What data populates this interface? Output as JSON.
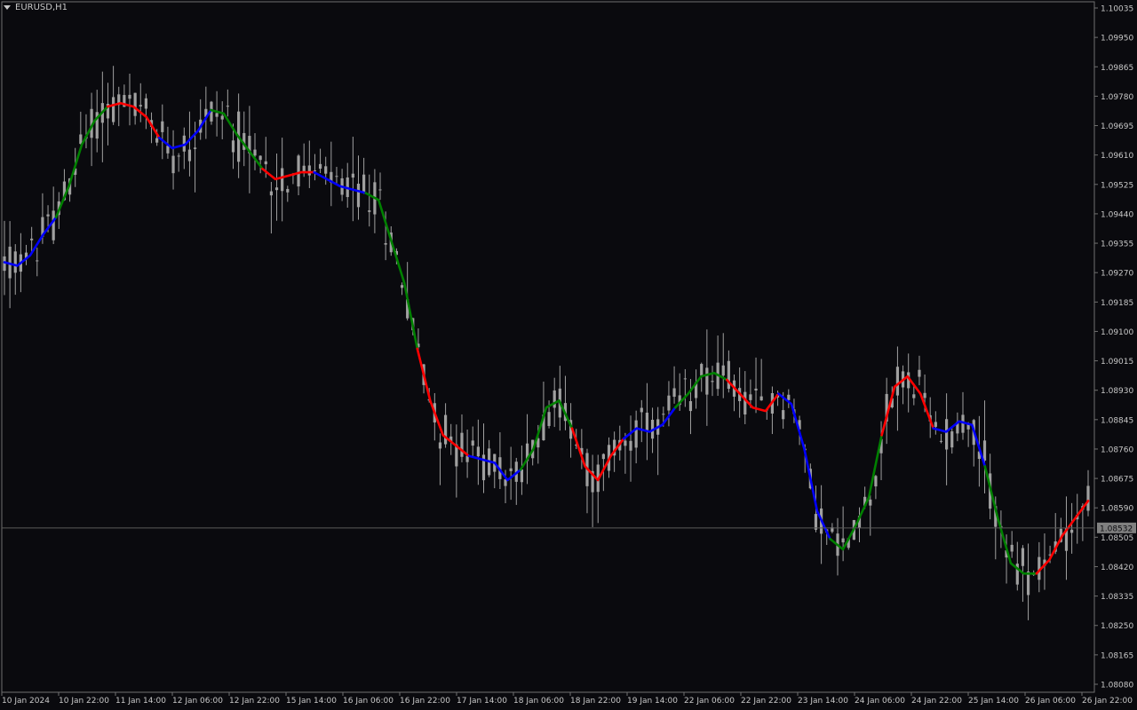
{
  "window": {
    "symbol_label": "EURUSD,H1"
  },
  "chart_data": {
    "type": "candlestick",
    "symbol": "EURUSD",
    "timeframe": "H1",
    "ylim": [
      1.0808,
      1.10035
    ],
    "y_ticks": [
      "1.10035",
      "1.09950",
      "1.09865",
      "1.09780",
      "1.09695",
      "1.09610",
      "1.09525",
      "1.09440",
      "1.09355",
      "1.09270",
      "1.09185",
      "1.09100",
      "1.09015",
      "1.08930",
      "1.08845",
      "1.08760",
      "1.08675",
      "1.08590",
      "1.08505",
      "1.08420",
      "1.08335",
      "1.08250",
      "1.08165",
      "1.08080"
    ],
    "x_ticks": [
      "10 Jan 2024",
      "10 Jan 22:00",
      "11 Jan 14:00",
      "12 Jan 06:00",
      "12 Jan 22:00",
      "15 Jan 14:00",
      "16 Jan 06:00",
      "16 Jan 22:00",
      "17 Jan 14:00",
      "18 Jan 06:00",
      "18 Jan 22:00",
      "19 Jan 14:00",
      "22 Jan 06:00",
      "22 Jan 22:00",
      "23 Jan 14:00",
      "24 Jan 06:00",
      "24 Jan 22:00",
      "25 Jan 14:00",
      "26 Jan 06:00",
      "26 Jan 22:00"
    ],
    "current_price": "1.08532",
    "colors": {
      "background": "#0a0a0e",
      "candle": "#a0a0a0",
      "up": "#008000",
      "down": "#ff0000",
      "flat": "#0000ff",
      "grid_line": "#5a5a5a",
      "price_tag_bg": "#808080"
    },
    "close_path": [
      [
        0,
        1.093
      ],
      [
        2,
        1.0929
      ],
      [
        4,
        1.0932
      ],
      [
        6,
        1.0938
      ],
      [
        8,
        1.0943
      ],
      [
        10,
        1.0952
      ],
      [
        12,
        1.0964
      ],
      [
        14,
        1.0971
      ],
      [
        16,
        1.0975
      ],
      [
        18,
        1.0976
      ],
      [
        20,
        1.0975
      ],
      [
        22,
        1.0972
      ],
      [
        24,
        1.0966
      ],
      [
        26,
        1.0963
      ],
      [
        28,
        1.0964
      ],
      [
        30,
        1.0968
      ],
      [
        32,
        1.0974
      ],
      [
        34,
        1.0973
      ],
      [
        36,
        1.0967
      ],
      [
        38,
        1.0962
      ],
      [
        40,
        1.0957
      ],
      [
        42,
        1.0954
      ],
      [
        44,
        1.0955
      ],
      [
        46,
        1.0956
      ],
      [
        48,
        1.0956
      ],
      [
        50,
        1.0954
      ],
      [
        52,
        1.0952
      ],
      [
        54,
        1.0951
      ],
      [
        56,
        1.095
      ],
      [
        58,
        1.0948
      ],
      [
        60,
        1.0936
      ],
      [
        62,
        1.0924
      ],
      [
        64,
        1.0905
      ],
      [
        66,
        1.089
      ],
      [
        68,
        1.088
      ],
      [
        70,
        1.0877
      ],
      [
        72,
        1.0874
      ],
      [
        74,
        1.0873
      ],
      [
        76,
        1.0872
      ],
      [
        78,
        1.0867
      ],
      [
        80,
        1.087
      ],
      [
        82,
        1.0876
      ],
      [
        84,
        1.0888
      ],
      [
        86,
        1.089
      ],
      [
        88,
        1.0882
      ],
      [
        90,
        1.0871
      ],
      [
        92,
        1.0867
      ],
      [
        94,
        1.0874
      ],
      [
        96,
        1.0879
      ],
      [
        98,
        1.0882
      ],
      [
        100,
        1.0881
      ],
      [
        102,
        1.0883
      ],
      [
        104,
        1.0888
      ],
      [
        106,
        1.0892
      ],
      [
        108,
        1.0897
      ],
      [
        110,
        1.0898
      ],
      [
        112,
        1.0896
      ],
      [
        114,
        1.0892
      ],
      [
        116,
        1.0888
      ],
      [
        118,
        1.0887
      ],
      [
        120,
        1.0892
      ],
      [
        122,
        1.0889
      ],
      [
        124,
        1.0876
      ],
      [
        126,
        1.0858
      ],
      [
        128,
        1.085
      ],
      [
        130,
        1.0847
      ],
      [
        132,
        1.0854
      ],
      [
        134,
        1.0862
      ],
      [
        136,
        1.088
      ],
      [
        138,
        1.0894
      ],
      [
        140,
        1.0897
      ],
      [
        142,
        1.0892
      ],
      [
        144,
        1.0882
      ],
      [
        146,
        1.0881
      ],
      [
        148,
        1.0884
      ],
      [
        150,
        1.0883
      ],
      [
        152,
        1.0871
      ],
      [
        154,
        1.0856
      ],
      [
        156,
        1.0843
      ],
      [
        158,
        1.084
      ],
      [
        160,
        1.084
      ],
      [
        162,
        1.0844
      ],
      [
        164,
        1.0851
      ],
      [
        166,
        1.0856
      ],
      [
        168,
        1.0861
      ]
    ],
    "segment_colors": [
      "flat",
      "up",
      "down",
      "flat",
      "up",
      "down",
      "flat",
      "up",
      "down",
      "flat",
      "up",
      "down",
      "flat",
      "up",
      "down",
      "flat",
      "up",
      "down",
      "flat",
      "up",
      "down",
      "flat",
      "up",
      "down",
      "flat",
      "up",
      "down"
    ]
  }
}
